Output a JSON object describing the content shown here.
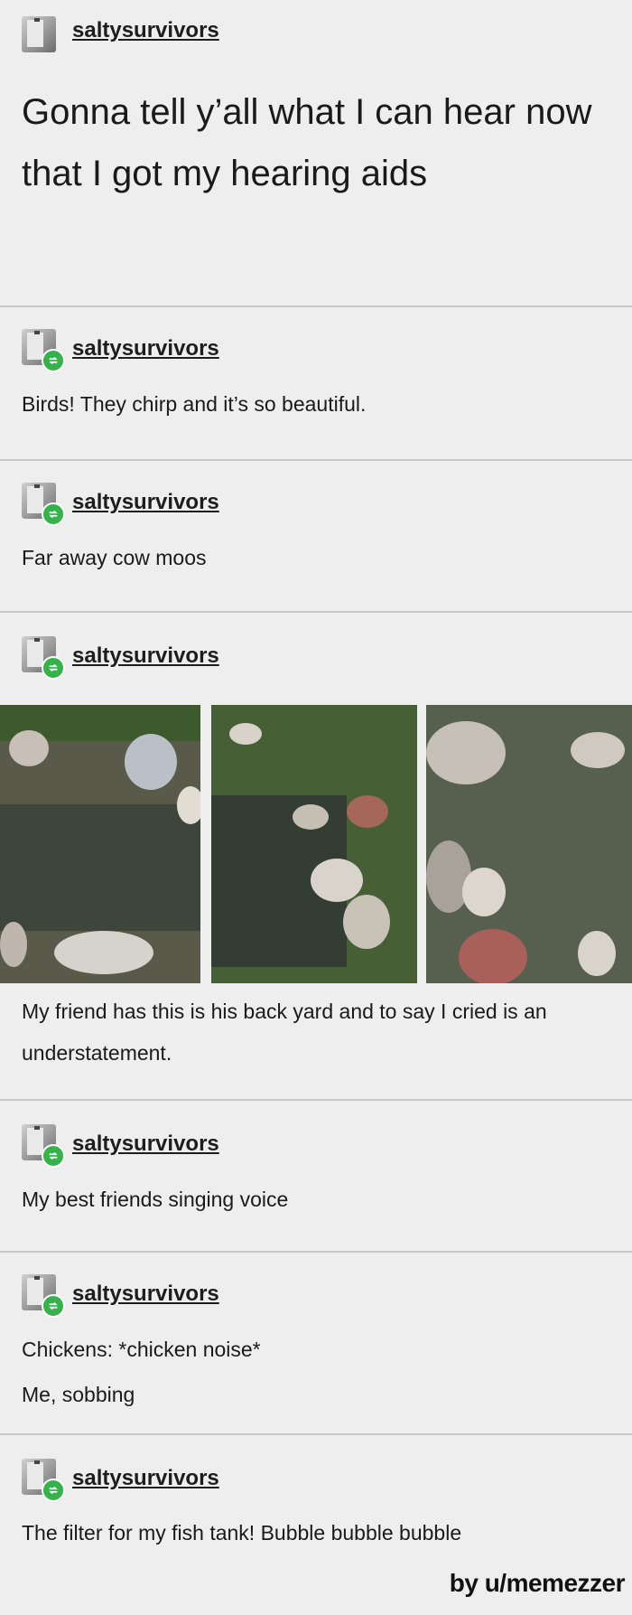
{
  "posts": [
    {
      "username": "saltysurvivors",
      "text": "Gonna tell y’all what I can hear now that I got my hearing aids"
    },
    {
      "username": "saltysurvivors",
      "text": "Birds! They chirp and it’s so beautiful."
    },
    {
      "username": "saltysurvivors",
      "text": "Far away cow moos"
    },
    {
      "username": "saltysurvivors",
      "text": "My friend has this is his back yard and to say I cried is an understatement."
    },
    {
      "username": "saltysurvivors",
      "text": "My best friends singing voice"
    },
    {
      "username": "saltysurvivors",
      "line1": "Chickens: *chicken noise*",
      "line2": "Me, sobbing"
    },
    {
      "username": "saltysurvivors",
      "text": "The filter for my fish tank! Bubble bubble bubble"
    }
  ],
  "credit": "by u/memezzer",
  "icons": {
    "avatar": "avatar-icon",
    "reblog": "reblog-icon"
  },
  "colors": {
    "reblog_badge": "#35b34a",
    "background": "#eeeeee",
    "divider": "#c9c9c9"
  }
}
